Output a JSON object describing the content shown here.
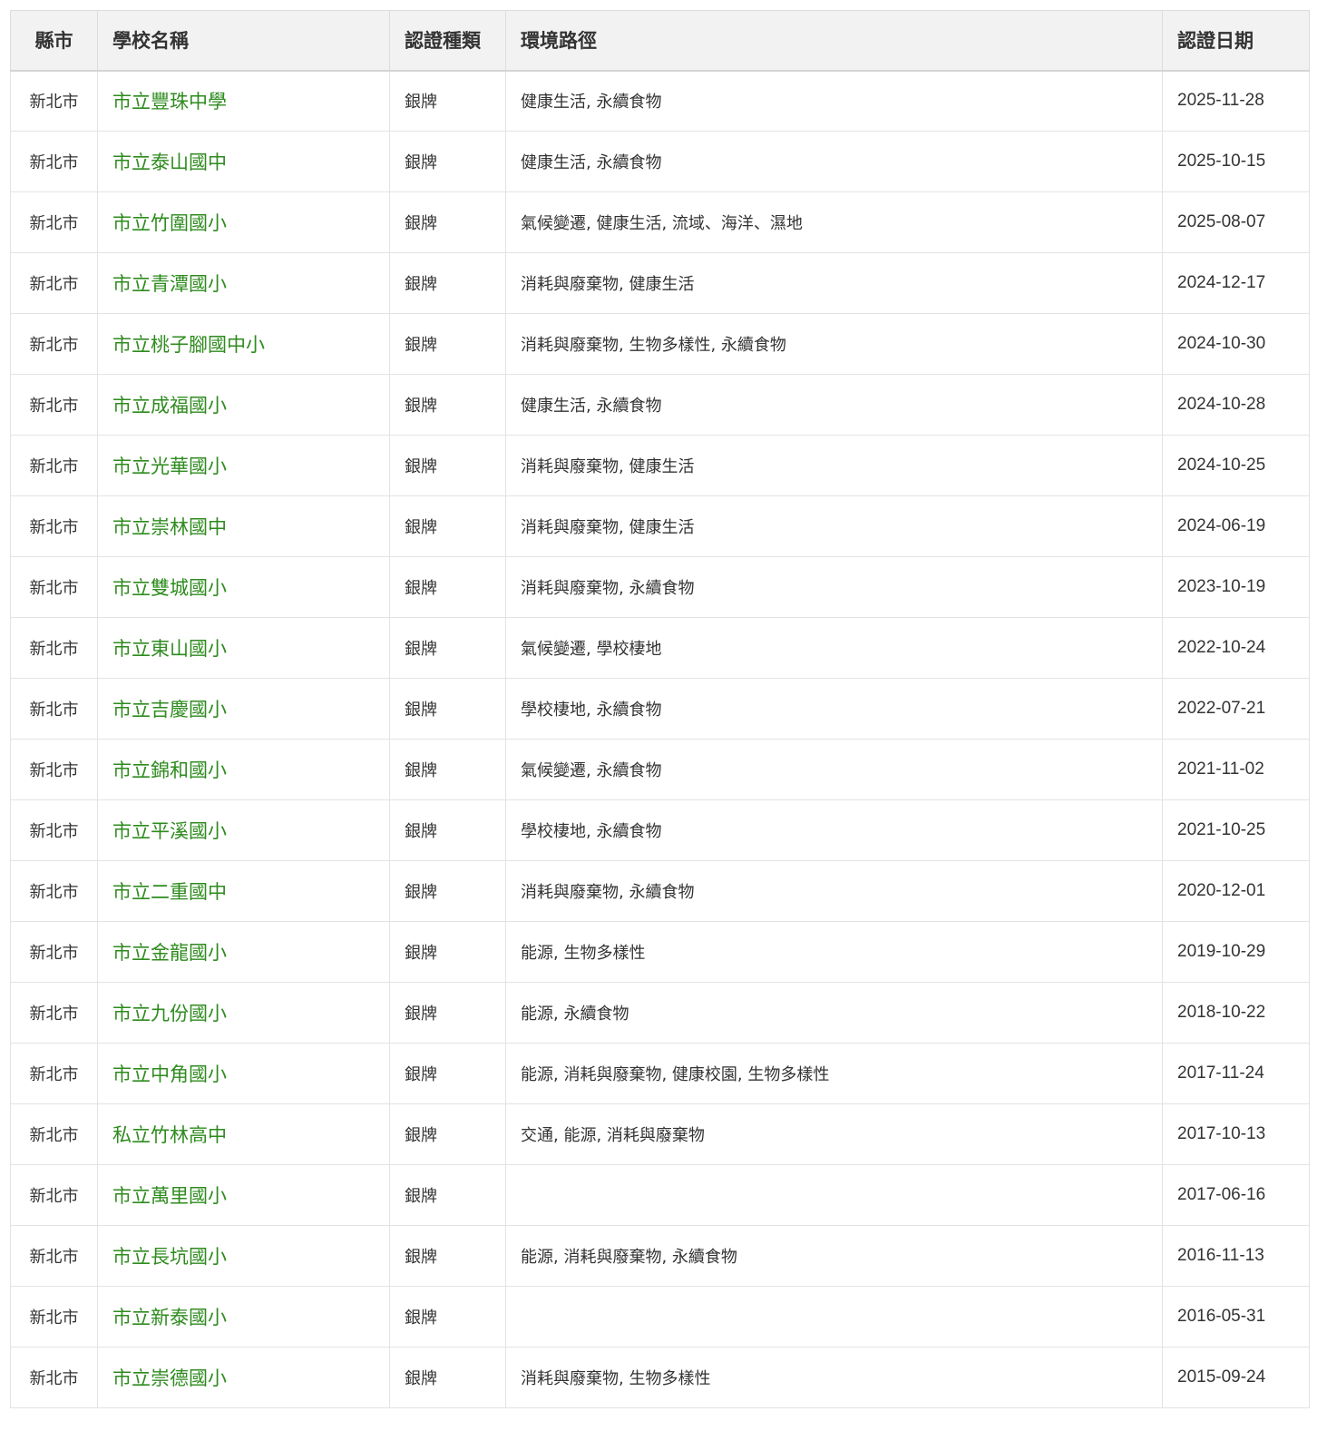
{
  "table": {
    "headers": {
      "county": "縣市",
      "school": "學校名稱",
      "cert_type": "認證種類",
      "paths": "環境路徑",
      "date": "認證日期"
    },
    "rows": [
      {
        "county": "新北市",
        "school": "市立豐珠中學",
        "cert_type": "銀牌",
        "paths": "健康生活, 永續食物",
        "date": "2025-11-28"
      },
      {
        "county": "新北市",
        "school": "市立泰山國中",
        "cert_type": "銀牌",
        "paths": "健康生活, 永續食物",
        "date": "2025-10-15"
      },
      {
        "county": "新北市",
        "school": "市立竹圍國小",
        "cert_type": "銀牌",
        "paths": "氣候變遷, 健康生活, 流域、海洋、濕地",
        "date": "2025-08-07"
      },
      {
        "county": "新北市",
        "school": "市立青潭國小",
        "cert_type": "銀牌",
        "paths": "消耗與廢棄物, 健康生活",
        "date": "2024-12-17"
      },
      {
        "county": "新北市",
        "school": "市立桃子腳國中小",
        "cert_type": "銀牌",
        "paths": "消耗與廢棄物, 生物多樣性, 永續食物",
        "date": "2024-10-30"
      },
      {
        "county": "新北市",
        "school": "市立成福國小",
        "cert_type": "銀牌",
        "paths": "健康生活, 永續食物",
        "date": "2024-10-28"
      },
      {
        "county": "新北市",
        "school": "市立光華國小",
        "cert_type": "銀牌",
        "paths": "消耗與廢棄物, 健康生活",
        "date": "2024-10-25"
      },
      {
        "county": "新北市",
        "school": "市立崇林國中",
        "cert_type": "銀牌",
        "paths": "消耗與廢棄物, 健康生活",
        "date": "2024-06-19"
      },
      {
        "county": "新北市",
        "school": "市立雙城國小",
        "cert_type": "銀牌",
        "paths": "消耗與廢棄物, 永續食物",
        "date": "2023-10-19"
      },
      {
        "county": "新北市",
        "school": "市立東山國小",
        "cert_type": "銀牌",
        "paths": "氣候變遷, 學校棲地",
        "date": "2022-10-24"
      },
      {
        "county": "新北市",
        "school": "市立吉慶國小",
        "cert_type": "銀牌",
        "paths": "學校棲地, 永續食物",
        "date": "2022-07-21"
      },
      {
        "county": "新北市",
        "school": "市立錦和國小",
        "cert_type": "銀牌",
        "paths": "氣候變遷, 永續食物",
        "date": "2021-11-02"
      },
      {
        "county": "新北市",
        "school": "市立平溪國小",
        "cert_type": "銀牌",
        "paths": "學校棲地, 永續食物",
        "date": "2021-10-25"
      },
      {
        "county": "新北市",
        "school": "市立二重國中",
        "cert_type": "銀牌",
        "paths": "消耗與廢棄物, 永續食物",
        "date": "2020-12-01"
      },
      {
        "county": "新北市",
        "school": "市立金龍國小",
        "cert_type": "銀牌",
        "paths": "能源, 生物多樣性",
        "date": "2019-10-29"
      },
      {
        "county": "新北市",
        "school": "市立九份國小",
        "cert_type": "銀牌",
        "paths": "能源, 永續食物",
        "date": "2018-10-22"
      },
      {
        "county": "新北市",
        "school": "市立中角國小",
        "cert_type": "銀牌",
        "paths": "能源, 消耗與廢棄物, 健康校園, 生物多樣性",
        "date": "2017-11-24"
      },
      {
        "county": "新北市",
        "school": "私立竹林高中",
        "cert_type": "銀牌",
        "paths": "交通, 能源, 消耗與廢棄物",
        "date": "2017-10-13"
      },
      {
        "county": "新北市",
        "school": "市立萬里國小",
        "cert_type": "銀牌",
        "paths": "",
        "date": "2017-06-16"
      },
      {
        "county": "新北市",
        "school": "市立長坑國小",
        "cert_type": "銀牌",
        "paths": "能源, 消耗與廢棄物, 永續食物",
        "date": "2016-11-13"
      },
      {
        "county": "新北市",
        "school": "市立新泰國小",
        "cert_type": "銀牌",
        "paths": "",
        "date": "2016-05-31"
      },
      {
        "county": "新北市",
        "school": "市立崇德國小",
        "cert_type": "銀牌",
        "paths": "消耗與廢棄物, 生物多樣性",
        "date": "2015-09-24"
      }
    ]
  },
  "colors": {
    "link": "#2e8b1e",
    "header_bg": "#f2f2f2",
    "border": "#e3e3e3"
  }
}
